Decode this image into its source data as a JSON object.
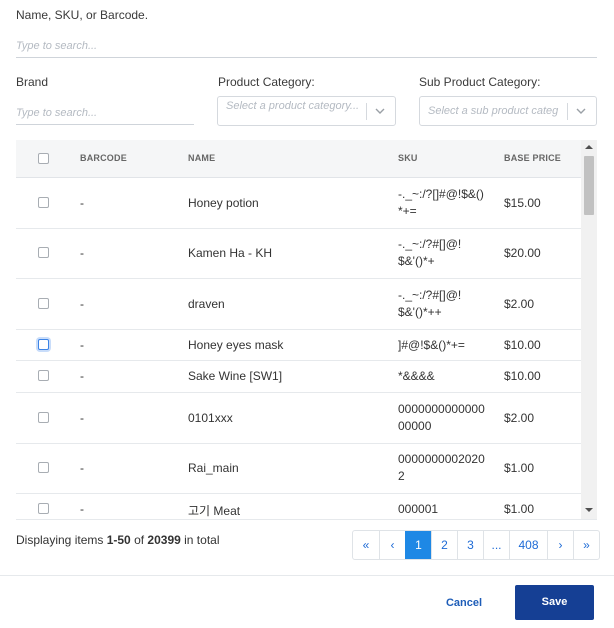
{
  "search": {
    "label": "Name, SKU, or Barcode.",
    "placeholder": "Type to search..."
  },
  "filters": {
    "brand_label": "Brand",
    "brand_placeholder": "Type to search...",
    "category_label": "Product Category:",
    "category_placeholder": "Select a product category...",
    "subcategory_label": "Sub Product Category:",
    "subcategory_placeholder": "Select a sub product categ"
  },
  "table": {
    "headers": {
      "barcode": "BARCODE",
      "name": "NAME",
      "sku": "SKU",
      "price": "BASE PRICE"
    },
    "rows": [
      {
        "barcode": "-",
        "name": "Honey potion",
        "sku": "-._~:/?[]#@!$&()*+=",
        "price": "$15.00"
      },
      {
        "barcode": "-",
        "name": "Kamen Ha - KH",
        "sku": "-._~:/?#[]@!$&'()*+",
        "price": "$20.00"
      },
      {
        "barcode": "-",
        "name": "draven",
        "sku": "-._~:/?#[]@!$&'()*++",
        "price": "$2.00"
      },
      {
        "barcode": "-",
        "name": "Honey eyes mask",
        "sku": "]#@!$&()*+=",
        "price": "$10.00"
      },
      {
        "barcode": "-",
        "name": "Sake Wine [SW1]",
        "sku": "*&&&&",
        "price": "$10.00"
      },
      {
        "barcode": "-",
        "name": "0101xxx",
        "sku": "000000000000000000",
        "price": "$2.00"
      },
      {
        "barcode": "-",
        "name": "Rai_main",
        "sku": "00000000020202",
        "price": "$1.00"
      },
      {
        "barcode": "-",
        "name": "고기 Meat",
        "sku": "000001",
        "price": "$1.00"
      }
    ]
  },
  "footer": {
    "prefix": "Displaying items ",
    "range": "1-50",
    "of": " of ",
    "total": "20399",
    "suffix": " in total"
  },
  "pagination": {
    "first": "«",
    "prev": "‹",
    "pages": [
      "1",
      "2",
      "3",
      "...",
      "408"
    ],
    "next": "›",
    "last": "»",
    "active_page": "1"
  },
  "actions": {
    "cancel": "Cancel",
    "save": "Save"
  },
  "colors": {
    "primary": "#153f94",
    "active_page": "#1e88e5",
    "link": "#1e5db8"
  }
}
